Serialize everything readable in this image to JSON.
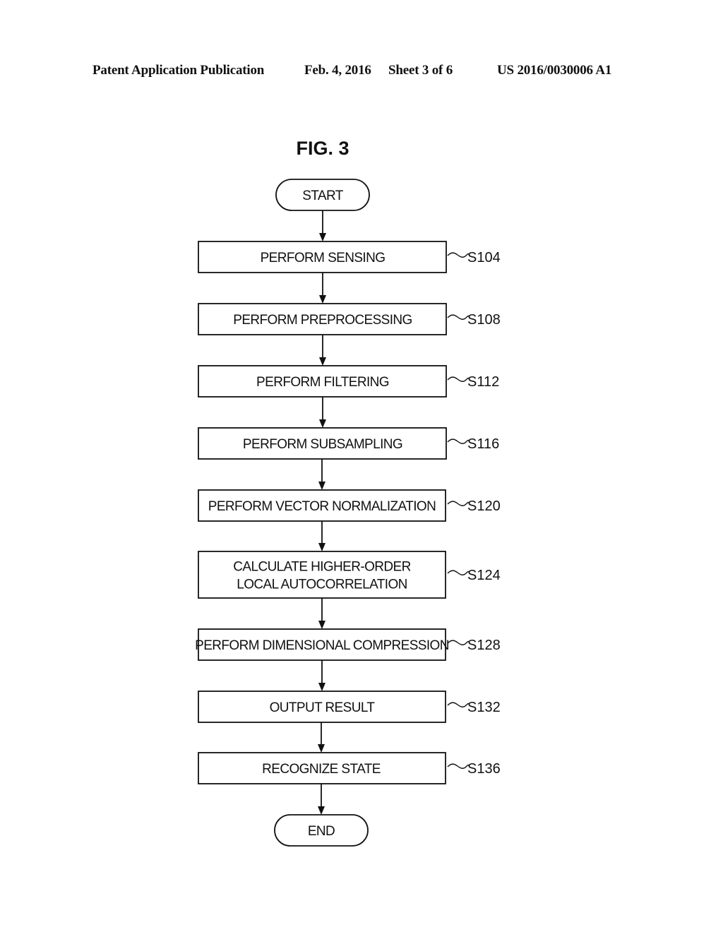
{
  "header": {
    "publication": "Patent Application Publication",
    "date": "Feb. 4, 2016",
    "sheet": "Sheet 3 of 6",
    "patent_number": "US 2016/0030006 A1"
  },
  "figure": {
    "title": "FIG. 3",
    "start_label": "START",
    "end_label": "END",
    "steps": [
      {
        "id": "S104",
        "lines": [
          "PERFORM SENSING"
        ]
      },
      {
        "id": "S108",
        "lines": [
          "PERFORM PREPROCESSING"
        ]
      },
      {
        "id": "S112",
        "lines": [
          "PERFORM FILTERING"
        ]
      },
      {
        "id": "S116",
        "lines": [
          "PERFORM SUBSAMPLING"
        ]
      },
      {
        "id": "S120",
        "lines": [
          "PERFORM VECTOR NORMALIZATION"
        ]
      },
      {
        "id": "S124",
        "lines": [
          "CALCULATE HIGHER-ORDER",
          "LOCAL AUTOCORRELATION"
        ]
      },
      {
        "id": "S128",
        "lines": [
          "PERFORM DIMENSIONAL COMPRESSION"
        ]
      },
      {
        "id": "S132",
        "lines": [
          "OUTPUT RESULT"
        ]
      },
      {
        "id": "S136",
        "lines": [
          "RECOGNIZE STATE"
        ]
      }
    ]
  }
}
